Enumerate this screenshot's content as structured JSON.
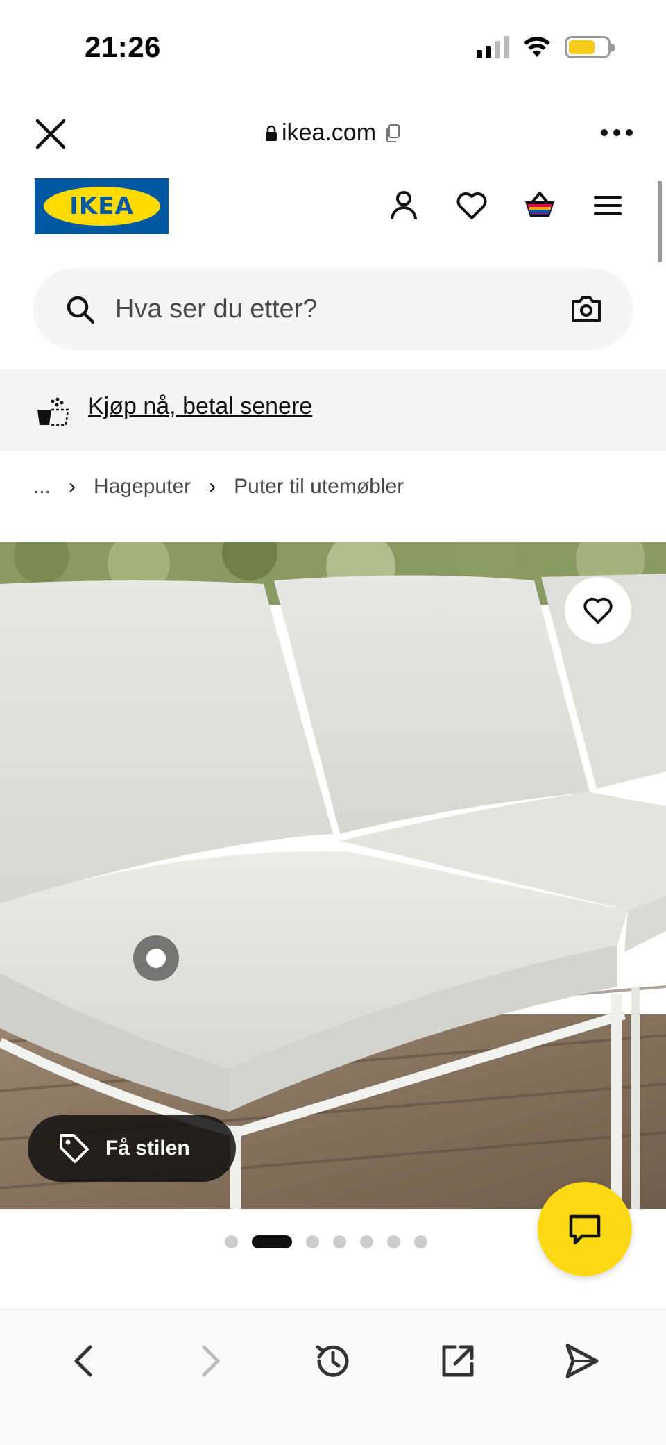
{
  "status_bar": {
    "time": "21:26",
    "battery_level": 0.68,
    "battery_color": "#f5cc1c"
  },
  "browser": {
    "url": "ikea.com",
    "icons": [
      "close-icon",
      "lock-icon",
      "copy-icon",
      "more-icon"
    ]
  },
  "header": {
    "logo_text": "IKEA",
    "brand_blue": "#0058a3",
    "brand_yellow": "#ffdb00",
    "icons": [
      "account-icon",
      "heart-icon",
      "basket-icon",
      "menu-icon"
    ]
  },
  "search": {
    "placeholder": "Hva ser du etter?",
    "icons": [
      "search-icon",
      "camera-icon"
    ]
  },
  "promo": {
    "text": "Kjøp nå, betal senere",
    "icon": "buy-now-pay-later-icon"
  },
  "breadcrumb": {
    "ellipsis": "...",
    "items": [
      "Hageputer",
      "Puter til utemøbler"
    ]
  },
  "product_image": {
    "style_button_label": "Få stilen",
    "favorite_icon": "heart-icon",
    "hotspot_icon": "hotspot-dot"
  },
  "carousel": {
    "total": 7,
    "active_index": 1
  },
  "chat": {
    "icon": "chat-icon",
    "color": "#fbd914"
  },
  "bottom_toolbar": {
    "items": [
      "back-icon",
      "forward-icon",
      "history-icon",
      "open-external-icon",
      "share-icon"
    ]
  }
}
